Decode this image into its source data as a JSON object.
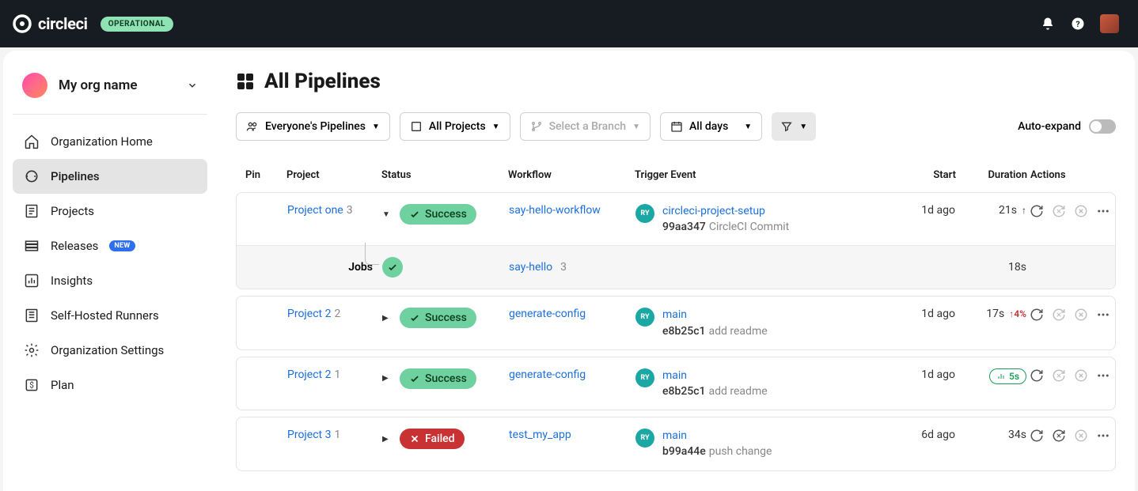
{
  "header": {
    "brand": "circleci",
    "status_badge": "OPERATIONAL"
  },
  "sidebar": {
    "org_name": "My org name",
    "items": [
      {
        "label": "Organization Home"
      },
      {
        "label": "Pipelines"
      },
      {
        "label": "Projects"
      },
      {
        "label": "Releases",
        "badge": "NEW"
      },
      {
        "label": "Insights"
      },
      {
        "label": "Self-Hosted Runners"
      },
      {
        "label": "Organization Settings"
      },
      {
        "label": "Plan"
      }
    ]
  },
  "page": {
    "title": "All Pipelines"
  },
  "filters": {
    "scope": "Everyone's Pipelines",
    "projects": "All Projects",
    "branch_placeholder": "Select a Branch",
    "days": "All days",
    "auto_expand": "Auto-expand"
  },
  "columns": {
    "pin": "Pin",
    "project": "Project",
    "status": "Status",
    "workflow": "Workflow",
    "trigger": "Trigger Event",
    "start": "Start",
    "duration": "Duration",
    "actions": "Actions"
  },
  "status_labels": {
    "success": "Success",
    "failed": "Failed"
  },
  "pipelines": [
    {
      "project": "Project one",
      "run": "3",
      "status": "success",
      "workflow": "say-hello-workflow",
      "trigger_avatar": "RY",
      "branch": "circleci-project-setup",
      "commit": "99aa347",
      "msg": "CircleCI Commit",
      "start": "1d ago",
      "duration": "21s",
      "duration_arrow": true,
      "jobs_label": "Jobs",
      "job": {
        "name": "say-hello",
        "num": "3",
        "duration": "18s"
      }
    },
    {
      "project": "Project 2",
      "run": "2",
      "status": "success",
      "workflow": "generate-config",
      "trigger_avatar": "RY",
      "branch": "main",
      "commit": "e8b25c1",
      "msg": "add readme",
      "start": "1d ago",
      "duration": "17s",
      "trend": "4%"
    },
    {
      "project": "Project 2",
      "run": "1",
      "status": "success",
      "workflow": "generate-config",
      "trigger_avatar": "RY",
      "branch": "main",
      "commit": "e8b25c1",
      "msg": "add readme",
      "start": "1d ago",
      "insight": "5s"
    },
    {
      "project": "Project 3",
      "run": "1",
      "status": "failed",
      "workflow": "test_my_app",
      "trigger_avatar": "RY",
      "branch": "main",
      "commit": "b99a44e",
      "msg": "push change",
      "start": "6d ago",
      "duration": "34s"
    }
  ]
}
